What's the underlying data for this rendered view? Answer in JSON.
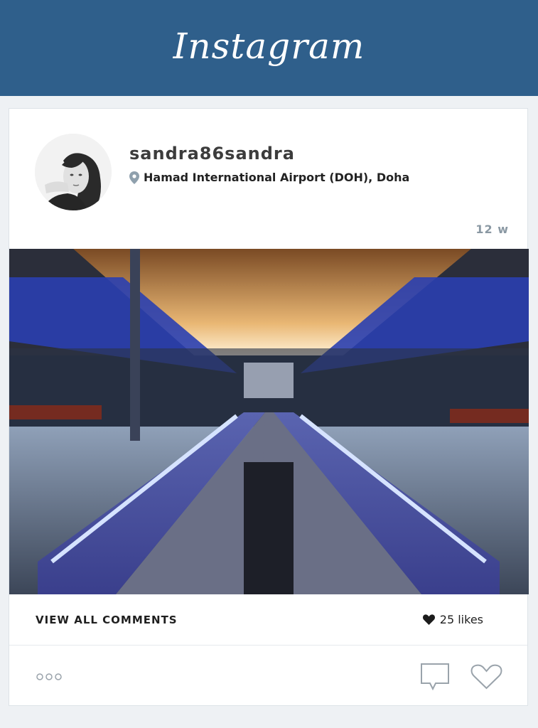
{
  "app": {
    "title": "Instagram"
  },
  "post": {
    "username": "sandra86sandra",
    "location": "Hamad International Airport (DOH), Doha",
    "time_ago": "12 w",
    "comments_link": "VIEW ALL COMMENTS",
    "likes": "25 likes"
  },
  "icons": {
    "location": "map-pin-icon",
    "likes": "heart-icon",
    "more": "more-options-icon",
    "comment": "comment-icon",
    "like": "heart-outline-icon"
  },
  "colors": {
    "header": "#2f5f8b",
    "muted": "#8a98a3",
    "background": "#eef1f4"
  }
}
